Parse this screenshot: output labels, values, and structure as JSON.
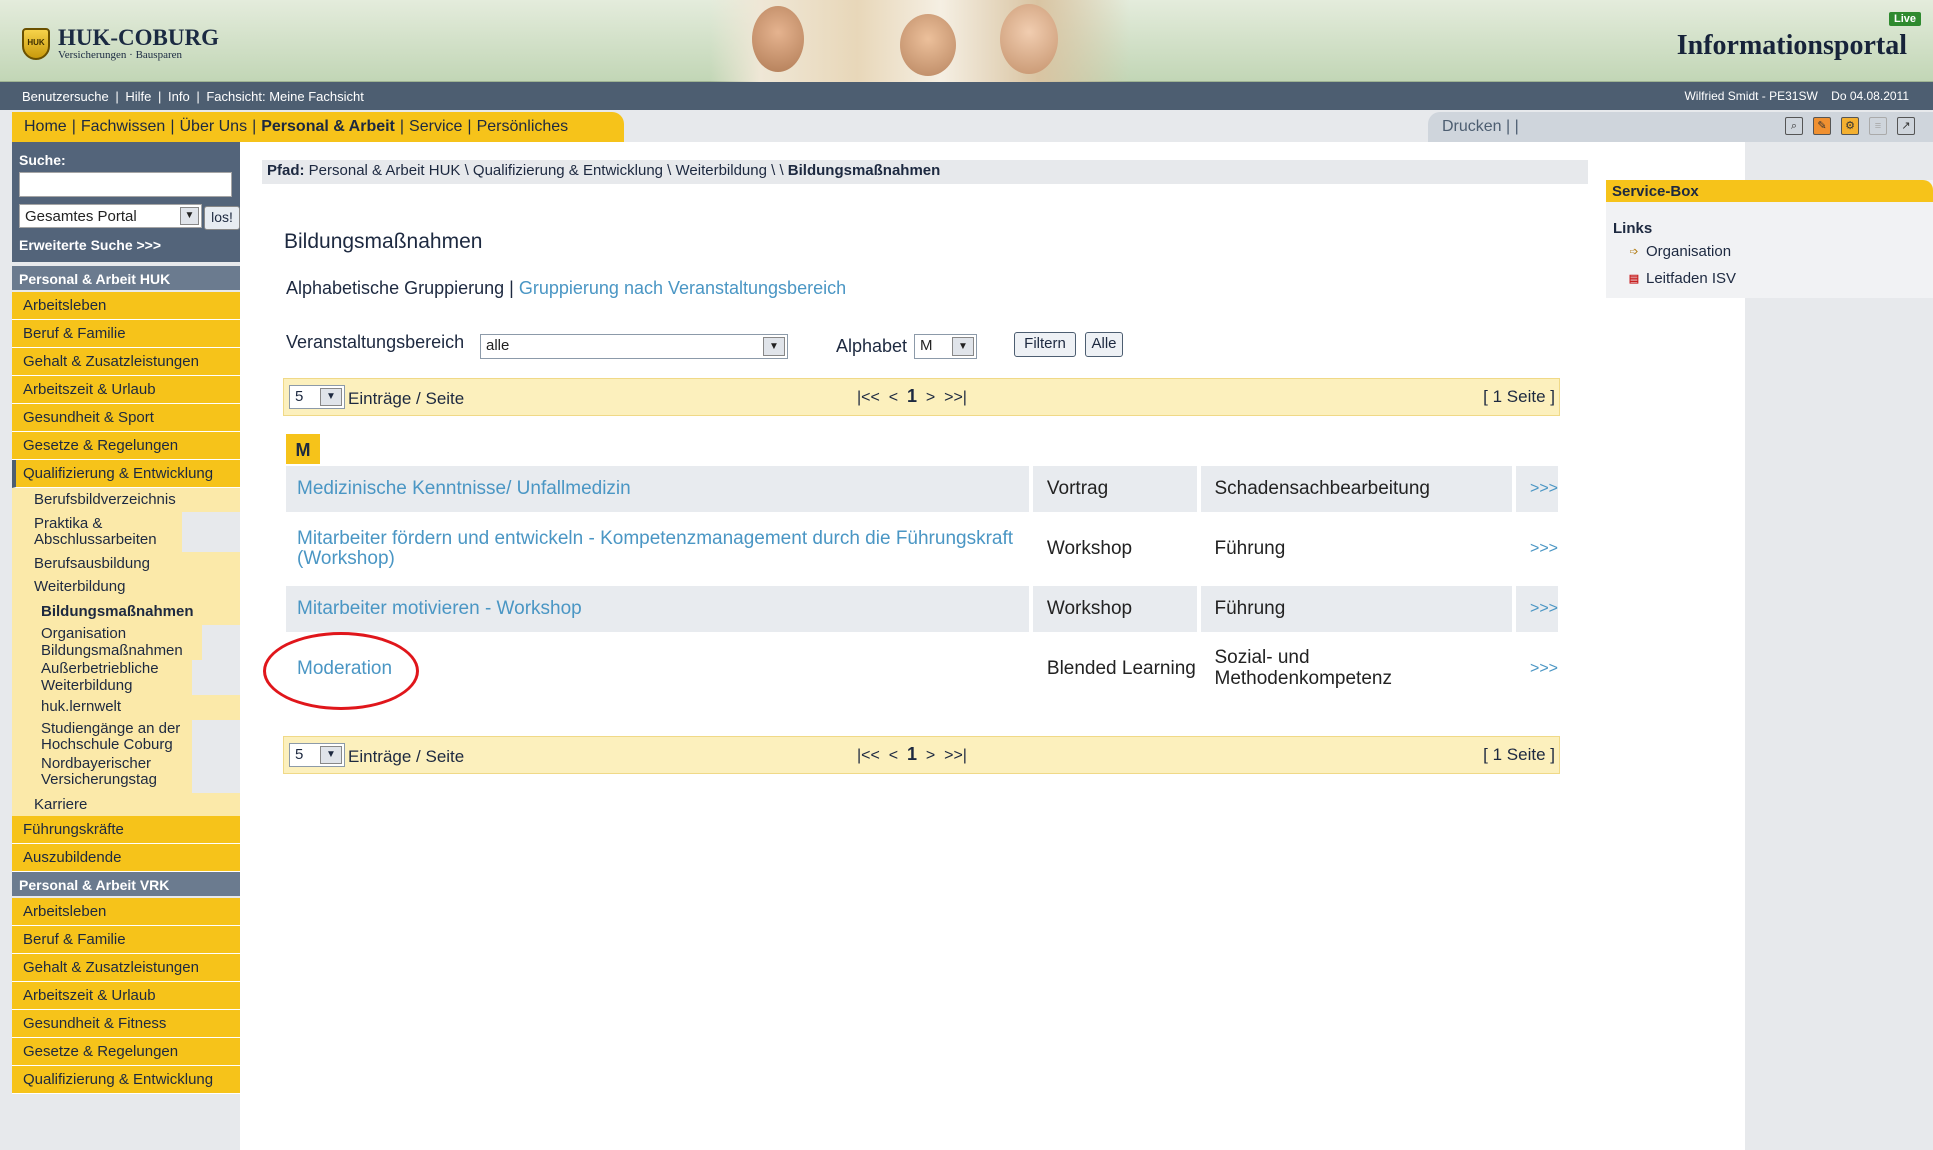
{
  "header": {
    "logo_title": "HUK-COBURG",
    "logo_subtitle": "Versicherungen · Bausparen",
    "portal_title": "Informationsportal",
    "live_badge": "Live"
  },
  "utility_bar": {
    "items": [
      "Benutzersuche",
      "|",
      "Hilfe",
      "|",
      "Info",
      "|",
      "Fachsicht: Meine Fachsicht"
    ],
    "user": "Wilfried Smidt - PE31SW",
    "date": "Do 04.08.2011"
  },
  "nav": {
    "items": [
      {
        "label": "Home"
      },
      {
        "label": "Fachwissen"
      },
      {
        "label": "Über Uns"
      },
      {
        "label": "Personal & Arbeit"
      },
      {
        "label": "Service"
      },
      {
        "label": "Persönliches"
      }
    ],
    "sep": "|",
    "print": "Drucken |  |"
  },
  "sidebar": {
    "search_label": "Suche:",
    "search_value": "",
    "scope_value": "Gesamtes Portal",
    "go_label": "los!",
    "advanced_search": "Erweiterte Suche >>>",
    "section1": "Personal & Arbeit HUK",
    "section1_items": [
      "Arbeitsleben",
      "Beruf & Familie",
      "Gehalt & Zusatzleistungen",
      "Arbeitszeit & Urlaub",
      "Gesundheit & Sport",
      "Gesetze & Regelungen",
      "Qualifizierung & Entwicklung"
    ],
    "sub_items": [
      "Berufsbildverzeichnis",
      "Praktika & Abschlussarbeiten",
      "Berufsausbildung",
      "Weiterbildung"
    ],
    "sub2_active": "Bildungsmaßnahmen",
    "sub2_items": [
      "Organisation Bildungsmaßnahmen",
      "Außerbetriebliche Weiterbildung",
      "huk.lernwelt",
      "Studiengänge an der Hochschule Coburg",
      "Nordbayerischer Versicherungstag"
    ],
    "sub_after": "Karriere",
    "section1_more": [
      "Führungskräfte",
      "Auszubildende"
    ],
    "section2": "Personal & Arbeit VRK",
    "section2_items": [
      "Arbeitsleben",
      "Beruf & Familie",
      "Gehalt & Zusatzleistungen",
      "Arbeitszeit & Urlaub",
      "Gesundheit & Fitness",
      "Gesetze & Regelungen",
      "Qualifizierung & Entwicklung"
    ]
  },
  "main": {
    "breadcrumb_prefix": "Pfad:",
    "breadcrumb_path": "Personal & Arbeit HUK \\ Qualifizierung & Entwicklung \\ Weiterbildung \\ \\",
    "breadcrumb_current": "Bildungsmaßnahmen",
    "title": "Bildungsmaßnahmen",
    "grouping_current": "Alphabetische Gruppierung",
    "grouping_sep": "|",
    "grouping_link": "Gruppierung nach Veranstaltungsbereich",
    "filter_area_label": "Veranstaltungsbereich",
    "filter_area_value": "alle",
    "filter_alpha_label": "Alphabet",
    "filter_alpha_value": "M",
    "filter_button": "Filtern",
    "all_button": "Alle",
    "pager": {
      "per_page": "5",
      "per_page_label": "Einträge / Seite",
      "first": "|<<",
      "prev": "<",
      "current": "1",
      "next": ">",
      "last": ">>|",
      "count": "[ 1 Seite ]"
    },
    "letter": "M",
    "rows": [
      {
        "title": "Medizinische Kenntnisse/ Unfallmedizin",
        "type": "Vortrag",
        "area": "Schadensachbearbeitung",
        "more": ">>>"
      },
      {
        "title": "Mitarbeiter fördern und entwickeln - Kompetenzmanagement durch die Führungskraft (Workshop)",
        "type": "Workshop",
        "area": "Führung",
        "more": ">>>"
      },
      {
        "title": "Mitarbeiter motivieren - Workshop",
        "type": "Workshop",
        "area": "Führung",
        "more": ">>>"
      },
      {
        "title": "Moderation",
        "type": "Blended Learning",
        "area": "Sozial- und Methodenkompetenz",
        "more": ">>>"
      }
    ]
  },
  "service_box": {
    "title": "Service-Box",
    "links_label": "Links",
    "links": [
      {
        "label": "Organisation",
        "icon": "folder-link-icon"
      },
      {
        "label": "Leitfaden ISV",
        "icon": "pdf-icon"
      }
    ]
  },
  "colors": {
    "accent_yellow": "#f6c31a",
    "nav_slate": "#4d5e71",
    "link_blue": "#4a96c4",
    "highlight_red": "#e0161b"
  }
}
